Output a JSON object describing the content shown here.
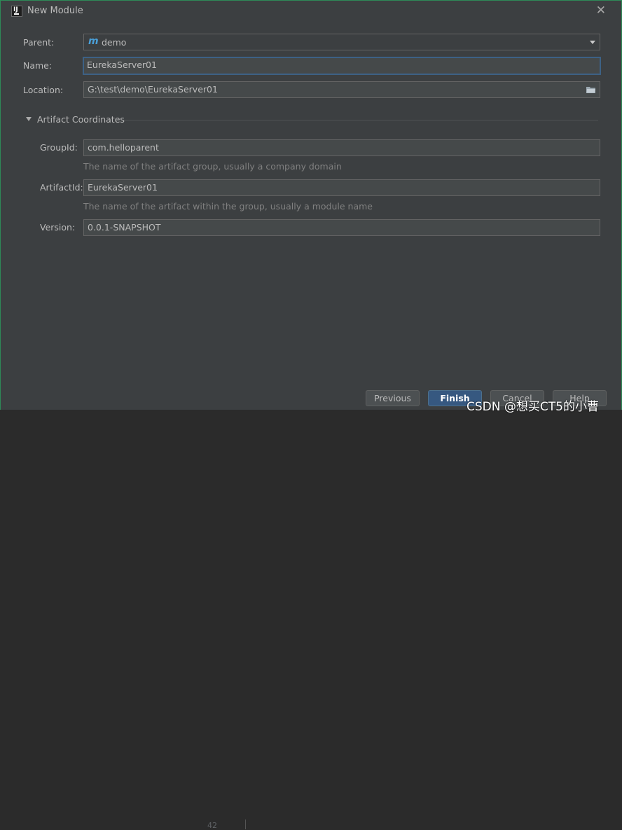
{
  "window": {
    "title": "New Module"
  },
  "form": {
    "parent_label": "Parent:",
    "parent_value": "demo",
    "name_label": "Name:",
    "name_value": "EurekaServer01",
    "location_label": "Location:",
    "location_value": "G:\\test\\demo\\EurekaServer01"
  },
  "artifact": {
    "section_title": "Artifact Coordinates",
    "groupid_label": "GroupId:",
    "groupid_value": "com.helloparent",
    "groupid_hint": "The name of the artifact group, usually a company domain",
    "artifactid_label": "ArtifactId:",
    "artifactid_value": "EurekaServer01",
    "artifactid_hint": "The name of the artifact within the group, usually a module name",
    "version_label": "Version:",
    "version_value": "0.0.1-SNAPSHOT"
  },
  "buttons": {
    "previous": "Previous",
    "finish": "Finish",
    "cancel": "Cancel",
    "help": "Help"
  },
  "background": {
    "line_number": "42"
  },
  "watermark": "CSDN @想买CT5的小曹",
  "colors": {
    "dialog_bg": "#3c3f41",
    "field_bg": "#45494a",
    "focus_border": "#3d6185",
    "default_button": "#365880",
    "window_border": "#2e8a57"
  },
  "icons": [
    "intellij-app-icon",
    "close-icon",
    "maven-module-icon",
    "dropdown-arrow-icon",
    "folder-icon",
    "collapse-triangle-icon"
  ]
}
